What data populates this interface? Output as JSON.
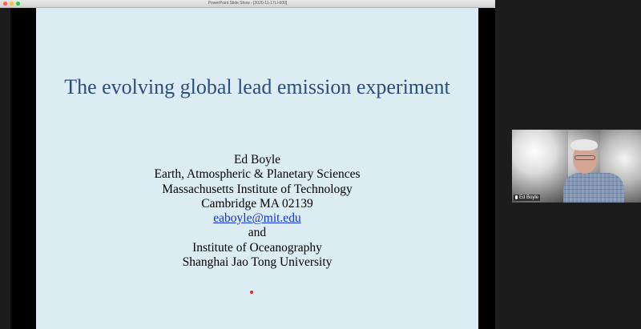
{
  "window": {
    "title": "PowerPoint Slide Show - [2020-11-17LI-600]"
  },
  "slide": {
    "title": "The evolving global lead emission experiment",
    "author": "Ed Boyle",
    "affiliation_lines": [
      "Earth, Atmospheric & Planetary Sciences",
      "Massachusetts Institute of Technology",
      "Cambridge MA 02139"
    ],
    "email": "eaboyle@mit.edu",
    "conjunction": "and",
    "second_affiliation_lines": [
      "Institute of Oceanography",
      "Shanghai Jao Tong University"
    ]
  },
  "video": {
    "participant_name": "Ed Boyle"
  },
  "colors": {
    "slide_background": "#dcecf3",
    "title_color": "#2c4d7c",
    "link_color": "#1133cc",
    "pointer_color": "#ee2222"
  }
}
